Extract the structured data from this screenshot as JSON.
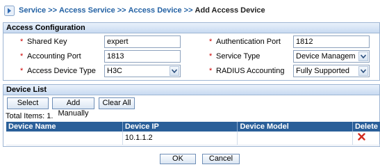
{
  "breadcrumb": {
    "items": [
      "Service",
      "Access Service",
      "Access Device"
    ],
    "separator": ">>",
    "current": "Add Access Device"
  },
  "access_config": {
    "title": "Access Configuration",
    "fields": {
      "shared_key": {
        "label": "Shared Key",
        "value": "expert"
      },
      "auth_port": {
        "label": "Authentication Port",
        "value": "1812"
      },
      "accounting_port": {
        "label": "Accounting Port",
        "value": "1813"
      },
      "service_type": {
        "label": "Service Type",
        "value": "Device Management S"
      },
      "device_type": {
        "label": "Access Device Type",
        "value": "H3C"
      },
      "radius_accounting": {
        "label": "RADIUS Accounting",
        "value": "Fully Supported"
      }
    },
    "required_marker": "*"
  },
  "device_list": {
    "title": "Device List",
    "buttons": {
      "select": "Select",
      "add_manually": "Add Manually",
      "clear_all": "Clear All"
    },
    "total_label": "Total Items: 1.",
    "columns": [
      "Device Name",
      "Device IP",
      "Device Model",
      "Delete"
    ],
    "rows": [
      {
        "device_name": "",
        "device_ip": "10.1.1.2",
        "device_model": ""
      }
    ]
  },
  "footer": {
    "ok": "OK",
    "cancel": "Cancel"
  },
  "colors": {
    "link": "#2462a4",
    "header_bar": "#2a5f99",
    "required": "#cc0000",
    "delete_icon": "#d22a1e"
  },
  "icons": [
    "breadcrumb-arrow-icon",
    "chevron-down-icon",
    "delete-x-icon"
  ]
}
